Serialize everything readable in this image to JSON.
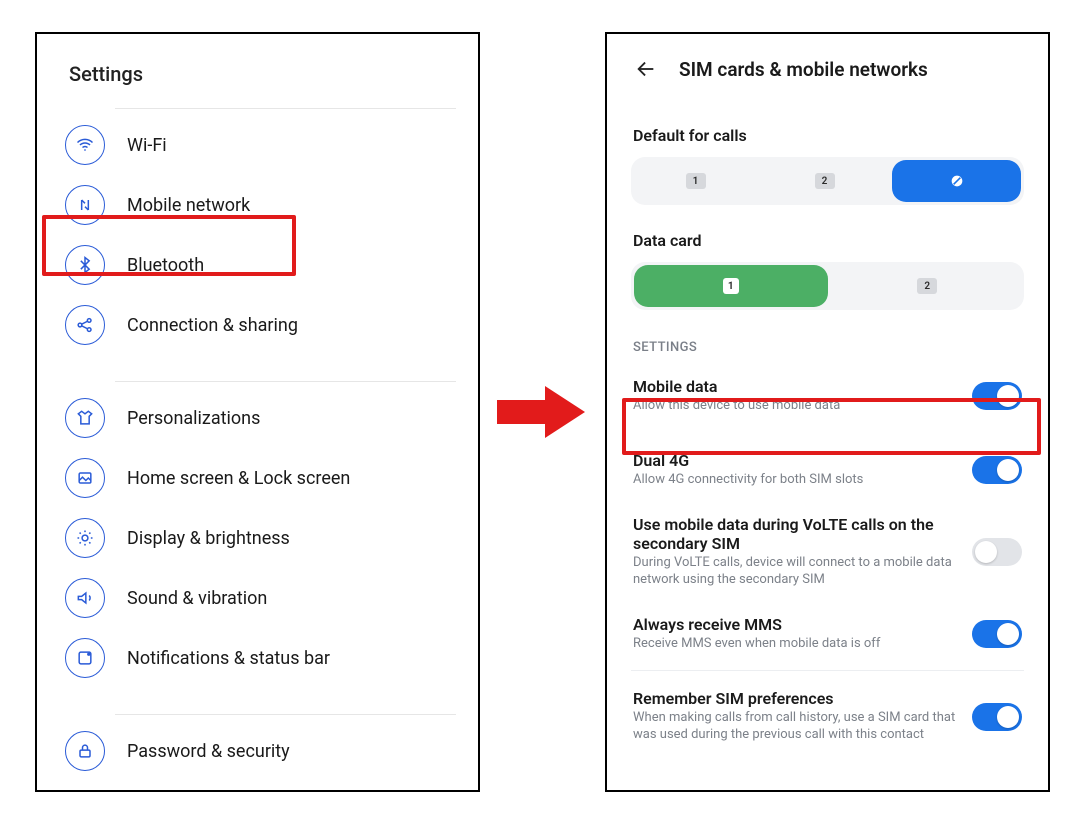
{
  "left": {
    "title": "Settings",
    "items": [
      {
        "id": "wifi",
        "label": "Wi-Fi",
        "icon": "wifi-icon"
      },
      {
        "id": "mobile-network",
        "label": "Mobile network",
        "icon": "mobile-network-icon"
      },
      {
        "id": "bluetooth",
        "label": "Bluetooth",
        "icon": "bluetooth-icon"
      },
      {
        "id": "connection-sharing",
        "label": "Connection & sharing",
        "icon": "share-icon"
      },
      {
        "id": "personalizations",
        "label": "Personalizations",
        "icon": "shirt-icon"
      },
      {
        "id": "home-lock",
        "label": "Home screen & Lock screen",
        "icon": "picture-icon"
      },
      {
        "id": "display-brightness",
        "label": "Display & brightness",
        "icon": "brightness-icon"
      },
      {
        "id": "sound-vibration",
        "label": "Sound & vibration",
        "icon": "speaker-icon"
      },
      {
        "id": "notifications-status",
        "label": "Notifications & status bar",
        "icon": "notification-icon"
      },
      {
        "id": "password-security",
        "label": "Password & security",
        "icon": "lock-icon"
      }
    ]
  },
  "right": {
    "title": "SIM cards & mobile networks",
    "default_calls_label": "Default for calls",
    "calls_options": {
      "opt1": "1",
      "opt2": "2",
      "opt3_icon": "no-sim-icon"
    },
    "data_card_label": "Data card",
    "data_options": {
      "opt1": "1",
      "opt2": "2"
    },
    "settings_header": "SETTINGS",
    "rows": {
      "mobile_data": {
        "title": "Mobile data",
        "sub": "Allow this device to use mobile data",
        "on": true
      },
      "dual_4g": {
        "title": "Dual 4G",
        "sub": "Allow 4G connectivity for both SIM slots",
        "on": true
      },
      "volte_secondary": {
        "title": "Use mobile data during VoLTE calls on the secondary SIM",
        "sub": "During VoLTE calls, device will connect to a mobile data network using the secondary SIM",
        "on": false
      },
      "always_mms": {
        "title": "Always receive MMS",
        "sub": "Receive MMS even when mobile data is off",
        "on": true
      },
      "remember_sim": {
        "title": "Remember SIM preferences",
        "sub": "When making calls from call history, use a SIM card that was used during the previous call with this contact",
        "on": true
      }
    }
  },
  "colors": {
    "accent_blue": "#1a73e8",
    "accent_green": "#4caf65",
    "highlight_red": "#e11b1b",
    "icon_blue": "#2a5bd7"
  }
}
